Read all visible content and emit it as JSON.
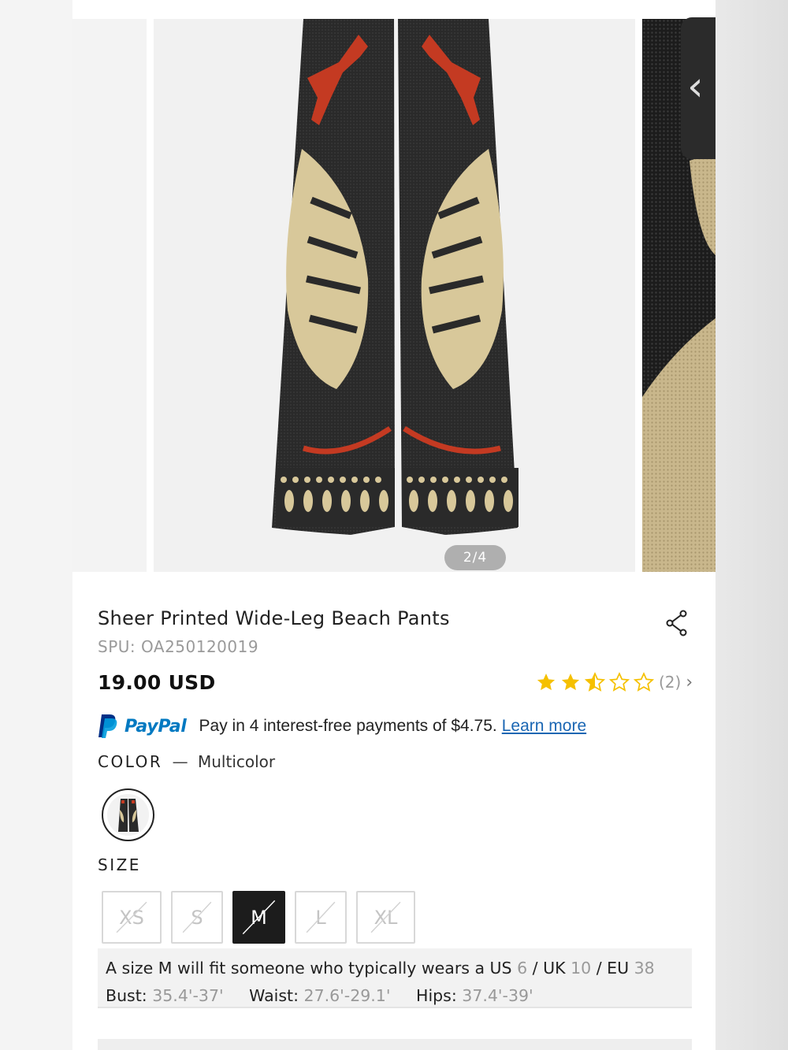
{
  "gallery": {
    "counter": "2/4",
    "prev_icon": "chevron-left-icon"
  },
  "product": {
    "title": "Sheer Printed Wide-Leg Beach Pants",
    "spu": "SPU: OA250120019",
    "price": "19.00 USD",
    "rating": {
      "stars": 2.5,
      "max": 5,
      "count": "(2)",
      "star_color": "#f5c000"
    },
    "share_icon": "share-icon"
  },
  "paypal": {
    "brand": "PayPal",
    "text": "Pay in 4 interest-free payments of $4.75.",
    "link": "Learn more"
  },
  "color": {
    "label": "COLOR",
    "dash": "—",
    "value": "Multicolor"
  },
  "size": {
    "label": "SIZE",
    "options": [
      "XS",
      "S",
      "M",
      "L",
      "XL"
    ],
    "selected": "M"
  },
  "fit": {
    "prefix": "A size M will fit someone who typically wears a US",
    "us": "6",
    "uk_label": "/ UK",
    "uk": "10",
    "eu_label": "/ EU",
    "eu": "38",
    "bust_label": "Bust:",
    "bust": "35.4'-37'",
    "waist_label": "Waist:",
    "waist": "27.6'-29.1'",
    "hips_label": "Hips:",
    "hips": "37.4'-39'"
  }
}
